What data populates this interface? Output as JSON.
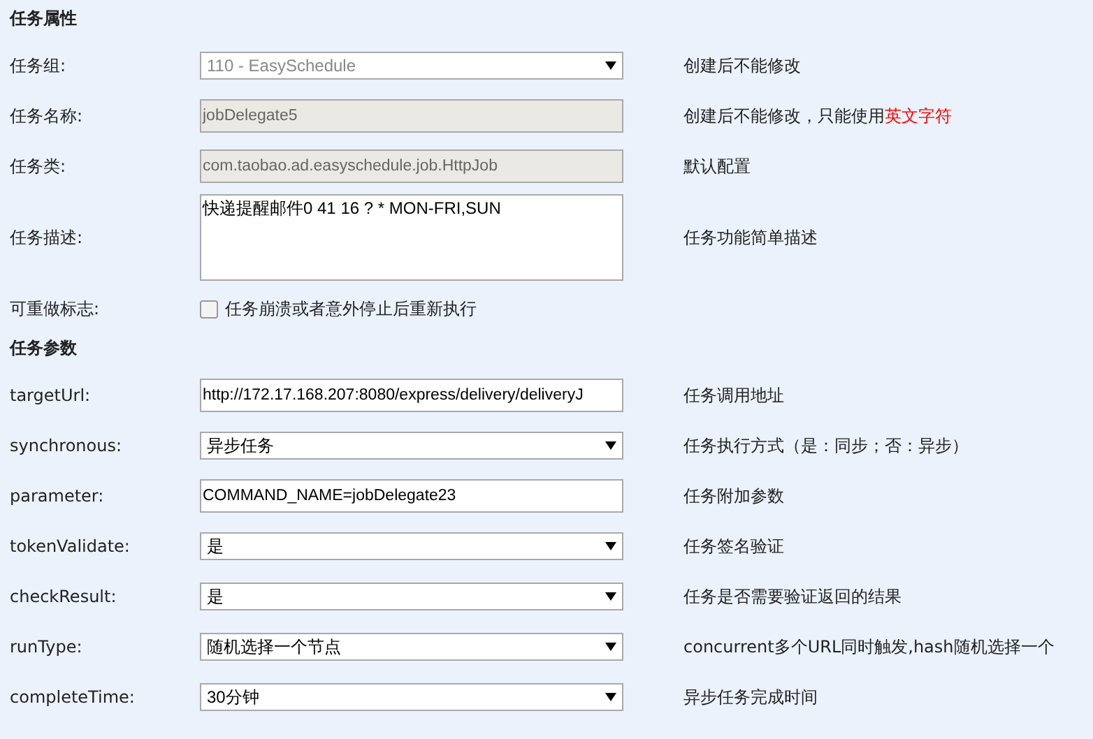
{
  "sections": [
    {
      "title": "任务属性",
      "rows": [
        {
          "label": "任务组:",
          "kind": "select",
          "value": "110 - EasySchedule",
          "disabled": true,
          "hint": "创建后不能修改"
        },
        {
          "label": "任务名称:",
          "kind": "input",
          "value": "jobDelegate5",
          "disabled": true,
          "hint": "创建后不能修改，只能使用",
          "hint_emphasis": "英文字符"
        },
        {
          "label": "任务类:",
          "kind": "input",
          "value": "com.taobao.ad.easyschedule.job.HttpJob",
          "disabled": true,
          "hint": "默认配置"
        },
        {
          "label": "任务描述:",
          "kind": "textarea",
          "value": "快递提醒邮件0 41 16 ? * MON-FRI,SUN",
          "disabled": false,
          "hint": "任务功能简单描述"
        },
        {
          "label": "可重做标志:",
          "kind": "checkbox",
          "value": "任务崩溃或者意外停止后重新执行",
          "checked": false
        }
      ]
    },
    {
      "title": "任务参数",
      "rows": [
        {
          "label": "targetUrl:",
          "kind": "input",
          "value": "http://172.17.168.207:8080/express/delivery/deliveryJ",
          "disabled": false,
          "hint": "任务调用地址"
        },
        {
          "label": "synchronous:",
          "kind": "select",
          "value": "异步任务",
          "disabled": false,
          "hint": "任务执行方式（是：同步；否：异步）"
        },
        {
          "label": "parameter:",
          "kind": "input",
          "value": "COMMAND_NAME=jobDelegate23",
          "disabled": false,
          "hint": "任务附加参数"
        },
        {
          "label": "tokenValidate:",
          "kind": "select",
          "value": "是",
          "disabled": false,
          "hint": "任务签名验证"
        },
        {
          "label": "checkResult:",
          "kind": "select",
          "value": "是",
          "disabled": false,
          "hint": "任务是否需要验证返回的结果"
        },
        {
          "label": "runType:",
          "kind": "select",
          "value": "随机选择一个节点",
          "disabled": false,
          "hint": "concurrent多个URL同时触发,hash随机选择一个"
        },
        {
          "label": "completeTime:",
          "kind": "select",
          "value": "30分钟",
          "disabled": false,
          "hint": "异步任务完成时间"
        }
      ]
    }
  ]
}
